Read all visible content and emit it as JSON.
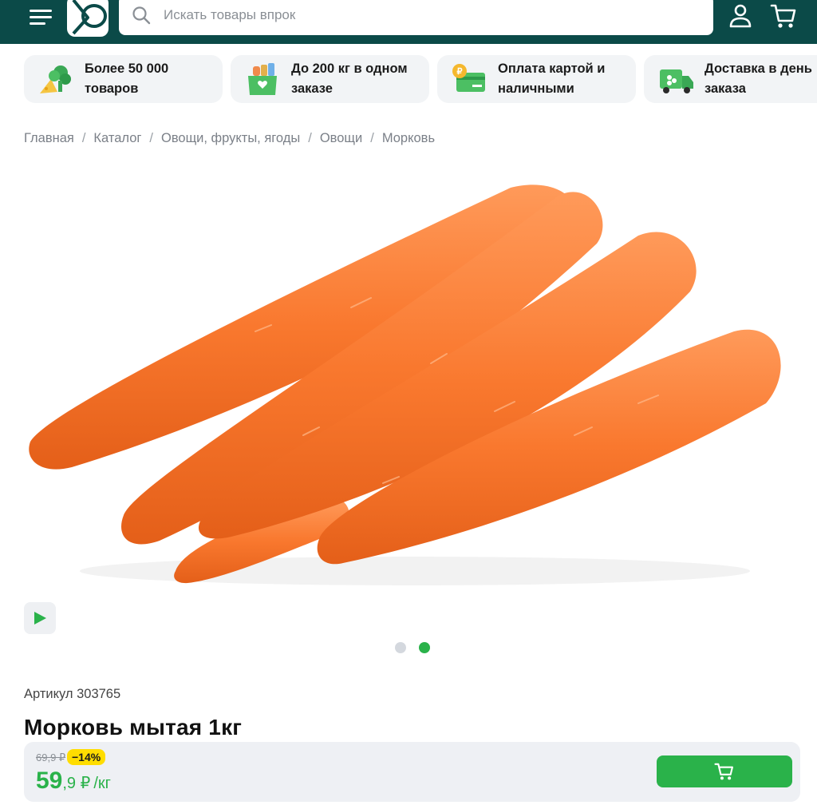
{
  "header": {
    "search_placeholder": "Искать товары впрок",
    "colors": {
      "header_bg": "#0b4a48",
      "accent": "#2ab24a"
    },
    "icons": [
      "menu-icon",
      "logo",
      "search-icon",
      "user-icon",
      "cart-icon"
    ]
  },
  "features": [
    {
      "line1": "Более 50 000",
      "line2": "товаров",
      "icon": "vegetables-icon"
    },
    {
      "line1": "До 200 кг в одном",
      "line2": "заказе",
      "icon": "grocery-box-icon"
    },
    {
      "line1": "Оплата картой и",
      "line2": "наличными",
      "icon": "payment-card-icon"
    },
    {
      "line1": "Доставка в день",
      "line2": "заказа",
      "icon": "delivery-truck-icon"
    }
  ],
  "breadcrumb": {
    "items": [
      "Главная",
      "Каталог",
      "Овощи, фрукты, ягоды",
      "Овощи",
      "Морковь"
    ],
    "separator": "/"
  },
  "gallery": {
    "image_alt": "Морковь",
    "active_dot_index": 1
  },
  "product": {
    "sku_label": "Артикул 303765",
    "title": "Морковь мытая 1кг",
    "old_price": "69,9 ₽",
    "discount": "−14%",
    "price_int": "59",
    "price_dec": ",9 ₽",
    "price_unit": "/кг"
  }
}
